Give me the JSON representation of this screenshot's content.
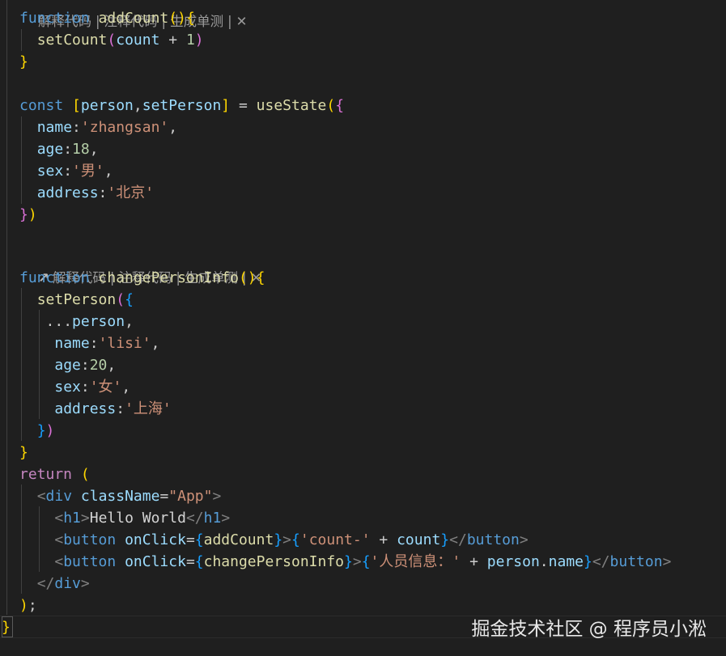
{
  "code_lens": {
    "explain": "解释代码",
    "comment": "注释代码",
    "unit_test": "生成单测",
    "divider": "|",
    "close": "✕"
  },
  "code": {
    "add_count_fn": "function",
    "add_count_name": "addCount",
    "set_count": "setCount",
    "count": "count",
    "one": "1",
    "const_kw": "const",
    "person": "person",
    "set_person": "setPerson",
    "use_state": "useState",
    "name_key": "name",
    "age_key": "age",
    "sex_key": "sex",
    "address_key": "address",
    "name_val1": "'zhangsan'",
    "age_val1": "18",
    "sex_val1": "'男'",
    "address_val1": "'北京'",
    "change_fn": "function",
    "change_name": "changePersonInfo",
    "spread": "...",
    "name_val2": "'lisi'",
    "age_val2": "20",
    "sex_val2": "'女'",
    "address_val2": "'上海'",
    "return_kw": "return",
    "div_tag": "div",
    "class_name_attr": "className",
    "app_str": "\"App\"",
    "h1_tag": "h1",
    "hello_text": "Hello World",
    "button_tag": "button",
    "on_click_attr": "onClick",
    "count_prefix": "'count-'",
    "person_prefix": "'人员信息：'",
    "dot_name": "name"
  },
  "watermark": "掘金技术社区 @ 程序员小淞"
}
